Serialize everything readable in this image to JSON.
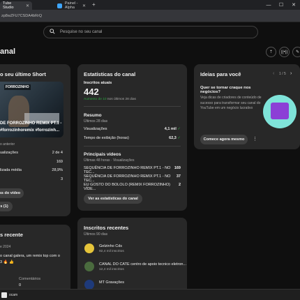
{
  "browser": {
    "tabs": [
      {
        "label": "Tube Studio",
        "active": true
      },
      {
        "label": "Painel - Alpha",
        "active": false
      }
    ],
    "url": "zp8wZFU7CSDA4bRrQ"
  },
  "header": {
    "search_placeholder": "Pesquise no seu canal",
    "page_title": "anal"
  },
  "latest_short": {
    "title": "o seu último Short",
    "thumb_badge": "FORROZINHO",
    "video_title": "DE FORROZINHO REMIX PT.1 -",
    "hashtags": "#forrozinhoremix #forrozinh...",
    "meta": "o anterior",
    "rank_label": "ualizações",
    "rank_value": "2 de 4",
    "views_value": "169",
    "avg_label": "lizada média",
    "avg_value": "28,9%",
    "likes_value": "3",
    "btn_analytics": "ss do vídeo",
    "btn_comments": "s (1)"
  },
  "recent": {
    "title": "s recente",
    "date": "e 2024",
    "comment": "o canal galera, um remix top com o",
    "emoji_line": "3 🔥 👍",
    "comments_label": "Comentários",
    "comments_value": "0"
  },
  "stats": {
    "title": "Estatísticas do canal",
    "subs_label": "Inscritos atuais",
    "subs_value": "442",
    "subs_delta": "Aumento de 10 nos últimos 28 dias",
    "summary_title": "Resumo",
    "summary_period": "Últimos 28 dias",
    "views_label": "Visualizações",
    "views_value": "4,1 mil",
    "watch_label": "Tempo de exibição (horas)",
    "watch_value": "62,3",
    "top_title": "Principais vídeos",
    "top_period": "Últimas 48 horas · Visualizações",
    "top_videos": [
      {
        "name": "SEQUÊNCIA DE FORROZINHO REMIX PT.1 - NO TEC...",
        "value": "169"
      },
      {
        "name": "SEQUÊNCIA DE FORROZINHO REMIX PT.1 - NO TEC...",
        "value": "37"
      },
      {
        "name": "EU GOSTO DO BOLOLO (REMIX FORROZINHO) VÍDE...",
        "value": "2"
      }
    ],
    "btn_label": "Ver as estatísticas do canal"
  },
  "subscribers": {
    "title": "Inscritos recentes",
    "period": "Últimos 90 dias",
    "items": [
      {
        "name": "Gelzinho Cds",
        "subs": "92,4 mil inscritos"
      },
      {
        "name": "CANAL DO CATE centro de apoio tecnico eletron...",
        "subs": "12,4 mil inscritos"
      },
      {
        "name": "MT Gravações",
        "subs": ""
      }
    ]
  },
  "ideas": {
    "title": "Ideias para você",
    "pager": "1 / 5",
    "heading": "Quer se tornar craque nos negócios?",
    "body": "Veja dicas de criadores de conteúdo de sucesso para transformar seu canal do YouTube em um negócio lucrativo",
    "btn_label": "Comece agora mesmo"
  },
  "taskbar": {
    "item": "ocam"
  },
  "colors": {
    "accent_green": "#2ba640",
    "brand_blue": "#3ea6ff"
  }
}
